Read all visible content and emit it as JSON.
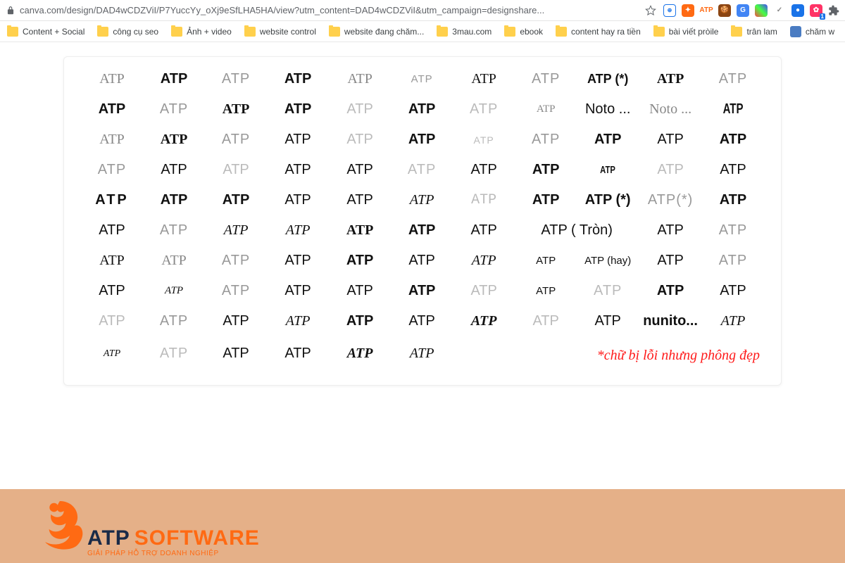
{
  "chrome": {
    "url": "canva.com/design/DAD4wCDZViI/P7YuccYy_oXj9eSfLHA5HA/view?utm_content=DAD4wCDZViI&utm_campaign=designshare..."
  },
  "bookmarks": [
    {
      "label": "Content + Social"
    },
    {
      "label": "công cụ seo"
    },
    {
      "label": "Ảnh + video"
    },
    {
      "label": "website control"
    },
    {
      "label": "website đang chăm..."
    },
    {
      "label": "3mau.com"
    },
    {
      "label": "ebook"
    },
    {
      "label": "content hay ra tiền"
    },
    {
      "label": "bài viết pròile"
    },
    {
      "label": "trân lam"
    },
    {
      "label": "chăm w"
    }
  ],
  "grid": {
    "r0": [
      "ATP",
      "ATP",
      "ATP",
      "ATP",
      "ATP",
      "ATP",
      "ATP",
      "ATP",
      "ATP (*)",
      "ATP",
      "ATP"
    ],
    "r1": [
      "ATP",
      "ATP",
      "ATP",
      "ATP",
      "ATP",
      "ATP",
      "ATP",
      "ATP",
      "Noto ...",
      "Noto ...",
      "ATP"
    ],
    "r2": [
      "ATP",
      "ATP",
      "ATP",
      "ATP",
      "ATP",
      "ATP",
      "ATP",
      "ATP",
      "ATP",
      "ATP",
      "ATP"
    ],
    "r3": [
      "ATP",
      "ATP",
      "ATP",
      "ATP",
      "ATP",
      "ATP",
      "ATP",
      "ATP",
      "ATP",
      "ATP",
      "ATP"
    ],
    "r4": [
      "ATP",
      "ATP",
      "ATP",
      "ATP",
      "ATP",
      "ATP",
      "ATP",
      "ATP",
      "ATP (*)",
      "ATP(*)",
      "ATP"
    ],
    "r5": [
      "ATP",
      "ATP",
      "ATP",
      "ATP",
      "ATP",
      "ATP",
      "ATP",
      "ATP ( Tròn)",
      "",
      "ATP",
      "ATP"
    ],
    "r6": [
      "ATP",
      "ATP",
      "ATP",
      "ATP",
      "ATP",
      "ATP",
      "ATP",
      "ATP",
      "ATP (hay)",
      "ATP",
      "ATP"
    ],
    "r7": [
      "ATP",
      "ATP",
      "ATP",
      "ATP",
      "ATP",
      "ATP",
      "ATP",
      "ATP",
      "ATP",
      "ATP",
      "ATP"
    ],
    "r8": [
      "ATP",
      "ATP",
      "ATP",
      "ATP",
      "ATP",
      "ATP",
      "ATP",
      "ATP",
      "ATP",
      "nunito...",
      "ATP"
    ],
    "r9": [
      "ATP",
      "ATP",
      "ATP",
      "ATP",
      "ATP",
      "ATP",
      "",
      "",
      "",
      "",
      ""
    ]
  },
  "note": "*chữ bị lỗi nhưng phông đẹp",
  "brand": {
    "atp": "ATP",
    "soft": "SOFTWARE",
    "sub": "GIẢI PHÁP HỖ TRỢ DOANH NGHIỆP"
  }
}
